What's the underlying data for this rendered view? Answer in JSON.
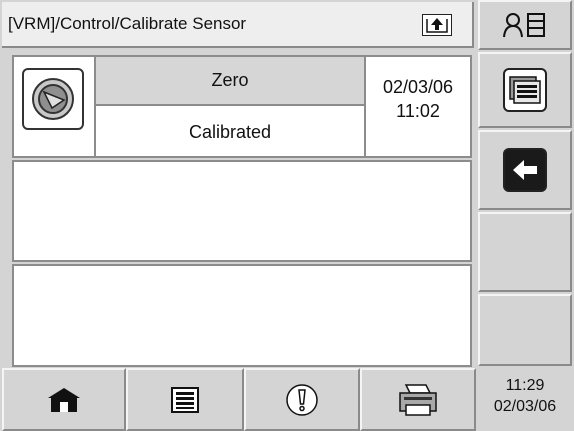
{
  "header": {
    "title": "[VRM]/Control/Calibrate Sensor",
    "upload_icon": "tray-up-arrow-icon"
  },
  "calibration_row": {
    "sensor_icon": "sensor-dial-icon",
    "mode": "Zero",
    "status": "Calibrated",
    "date": "02/03/06",
    "time": "11:02"
  },
  "side_menu": {
    "user_icon": "user-list-icon",
    "list_icon": "stacked-list-icon",
    "back_icon": "back-arrow-icon"
  },
  "bottom_bar": {
    "home_icon": "home-icon",
    "menu_icon": "list-icon",
    "alarm_icon": "alarm-icon",
    "print_icon": "printer-icon"
  },
  "clock": {
    "time": "11:29",
    "date": "02/03/06"
  }
}
